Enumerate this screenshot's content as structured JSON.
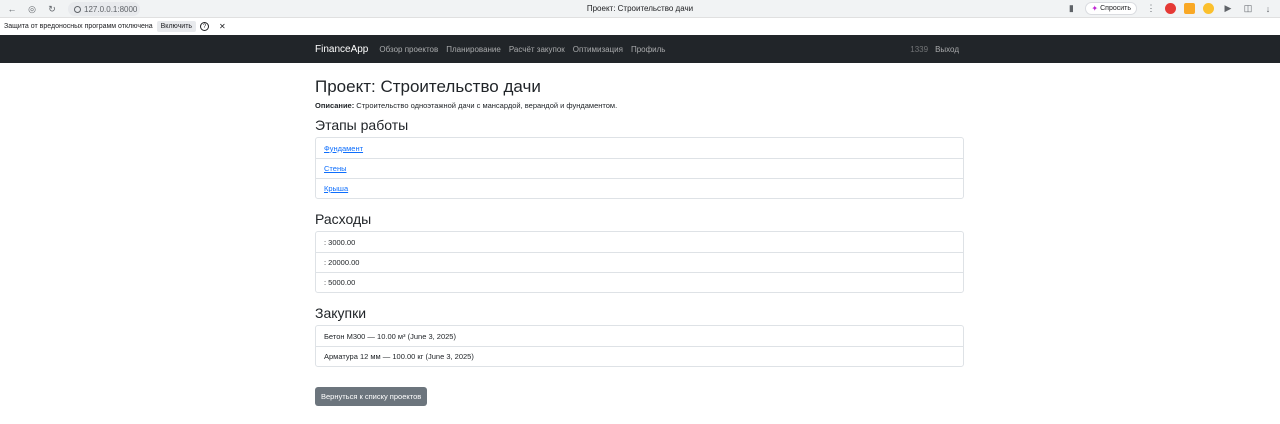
{
  "browser": {
    "url": "127.0.0.1:8000",
    "tab_title": "Проект: Строительство дачи",
    "ask_label": "Спросить"
  },
  "infobar": {
    "message": "Защита от вредоносных программ отключена",
    "enable_label": "Включить"
  },
  "navbar": {
    "brand": "FinanceApp",
    "links": [
      "Обзор проектов",
      "Планирование",
      "Расчёт закупок",
      "Оптимизация",
      "Профиль"
    ],
    "user_id": "1339",
    "logout": "Выход"
  },
  "project": {
    "title": "Проект: Строительство дачи",
    "description_label": "Описание:",
    "description": " Строительство одноэтажной дачи с мансардой, верандой и фундаментом."
  },
  "stages": {
    "heading": "Этапы работы",
    "items": [
      "Фундамент",
      "Стены",
      "Крыша"
    ]
  },
  "expenses": {
    "heading": "Расходы",
    "items": [
      ": 3000.00",
      ": 20000.00",
      ": 5000.00"
    ]
  },
  "purchases": {
    "heading": "Закупки",
    "items": [
      "Бетон М300 — 10.00 м³ (June 3, 2025)",
      "Арматура 12 мм — 100.00 кг (June 3, 2025)"
    ]
  },
  "back_button": "Вернуться к списку проектов",
  "colors": {
    "navbar_bg": "#212529",
    "link": "#0d6efd",
    "secondary_button": "#6c757d"
  }
}
